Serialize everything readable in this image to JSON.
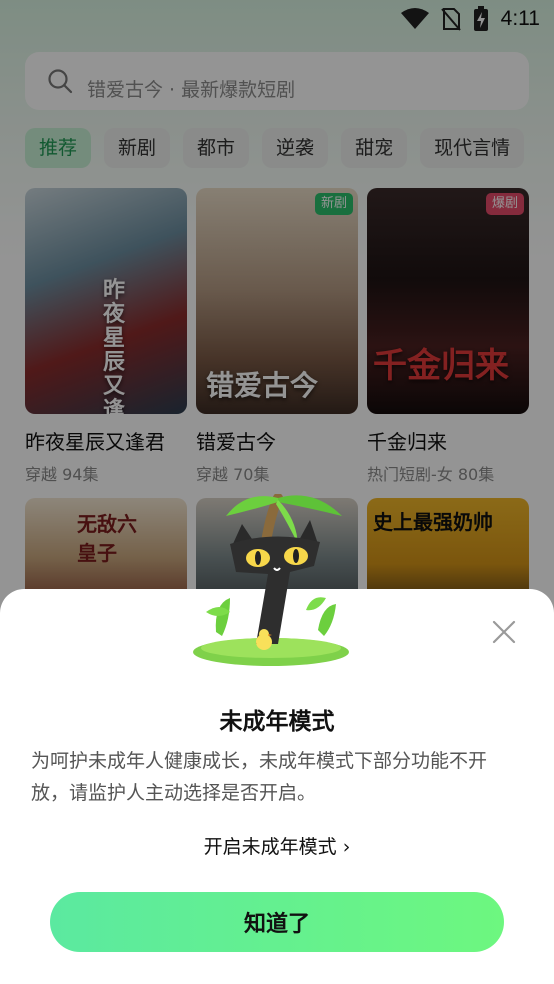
{
  "status_bar": {
    "time": "4:11"
  },
  "search": {
    "placeholder": "错爱古今 · 最新爆款短剧"
  },
  "tabs": [
    "推荐",
    "新剧",
    "都市",
    "逆袭",
    "甜宠",
    "现代言情"
  ],
  "active_tab": "推荐",
  "dramas": [
    {
      "title": "昨夜星辰又逢君",
      "meta": "穿越 94集",
      "badge": "",
      "poster_text": "昨夜星辰又逢君"
    },
    {
      "title": "错爱古今",
      "meta": "穿越 70集",
      "badge": "新剧",
      "poster_text": "错爱古今"
    },
    {
      "title": "千金归来",
      "meta": "热门短剧-女 80集",
      "badge": "爆剧",
      "poster_text": "千金归来"
    }
  ],
  "second_row": [
    {
      "poster_text": "无敌六皇子"
    },
    {
      "poster_text": ""
    },
    {
      "poster_text": "史上最强奶帅"
    }
  ],
  "modal": {
    "title": "未成年模式",
    "description": "为呵护未成年人健康成长，未成年模式下部分功能不开放，请监护人主动选择是否开启。",
    "enable_link": "开启未成年模式",
    "enable_chevron": "›",
    "confirm_button": "知道了"
  },
  "colors": {
    "accent_green": "#1f9a55",
    "button_gradient_start": "#5be9a0",
    "button_gradient_end": "#6df77f",
    "badge_new": "#2cbf6b",
    "badge_hot": "#e64a6a"
  }
}
